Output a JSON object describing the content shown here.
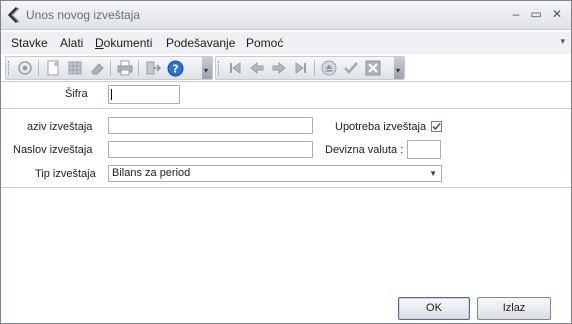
{
  "window": {
    "title": "Unos novog izveštaja",
    "minimize_glyph": "–",
    "maximize_glyph": "▭",
    "close_glyph": "✕"
  },
  "menu": {
    "items": [
      "Stavke",
      "Alati",
      "Dokumenti",
      "Podešavanje",
      "Pomoć"
    ],
    "overflow_glyph": "▾"
  },
  "toolbar1": {
    "icons": [
      "refresh-icon",
      "new-document-icon",
      "grid-icon",
      "eraser-icon",
      "print-icon",
      "exit-icon",
      "help-icon"
    ]
  },
  "toolbar2": {
    "icons": [
      "first-icon",
      "previous-icon",
      "next-icon",
      "last-icon",
      "eject-icon",
      "check-icon",
      "cancel-icon"
    ]
  },
  "form": {
    "sifra_label": "Šifra",
    "sifra_value": "",
    "naziv_label": "aziv izveštaja",
    "naziv_value": "",
    "upotreba_label": "Upotreba izveštaja",
    "upotreba_checked": true,
    "naslov_label": "Naslov izveštaja",
    "naslov_value": "",
    "devizna_label": "Devizna valuta :",
    "devizna_value": "",
    "tip_label": "Tip izveštaja",
    "tip_value": "Bilans za period"
  },
  "buttons": {
    "ok": "OK",
    "cancel": "Izlaz"
  },
  "colors": {
    "accent": "#2f5aa8",
    "help_icon": "#2f6fd0",
    "disabled_icon": "#9aa0aa"
  }
}
